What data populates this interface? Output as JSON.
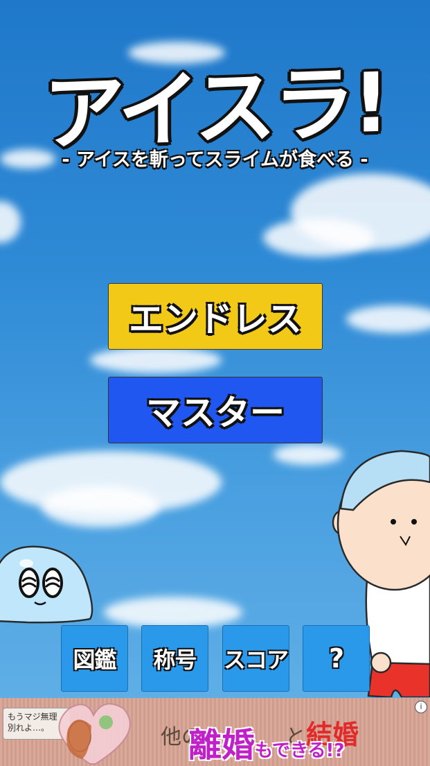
{
  "title": "アイスラ!",
  "subtitle": "- アイスを斬ってスライムが食べる -",
  "buttons": {
    "endless": "エンドレス",
    "master": "マスター"
  },
  "bottom_menu": [
    {
      "label": "図鑑"
    },
    {
      "label": "称号"
    },
    {
      "label": "スコア"
    },
    {
      "label": "?"
    }
  ],
  "ad": {
    "bubble_text": "もうマジ無理\n別れよ…。",
    "line1_a": "他の",
    "line1_b": "と",
    "line1_c": "結婚",
    "line2_a": "離婚",
    "line2_b": "もできる!?",
    "info_icon": "i"
  },
  "colors": {
    "endless_button": "#f1c916",
    "master_button": "#2057f0",
    "menu_button": "#2b99ea",
    "slime": "#bfe6fb",
    "shorts": "#e8322a"
  }
}
